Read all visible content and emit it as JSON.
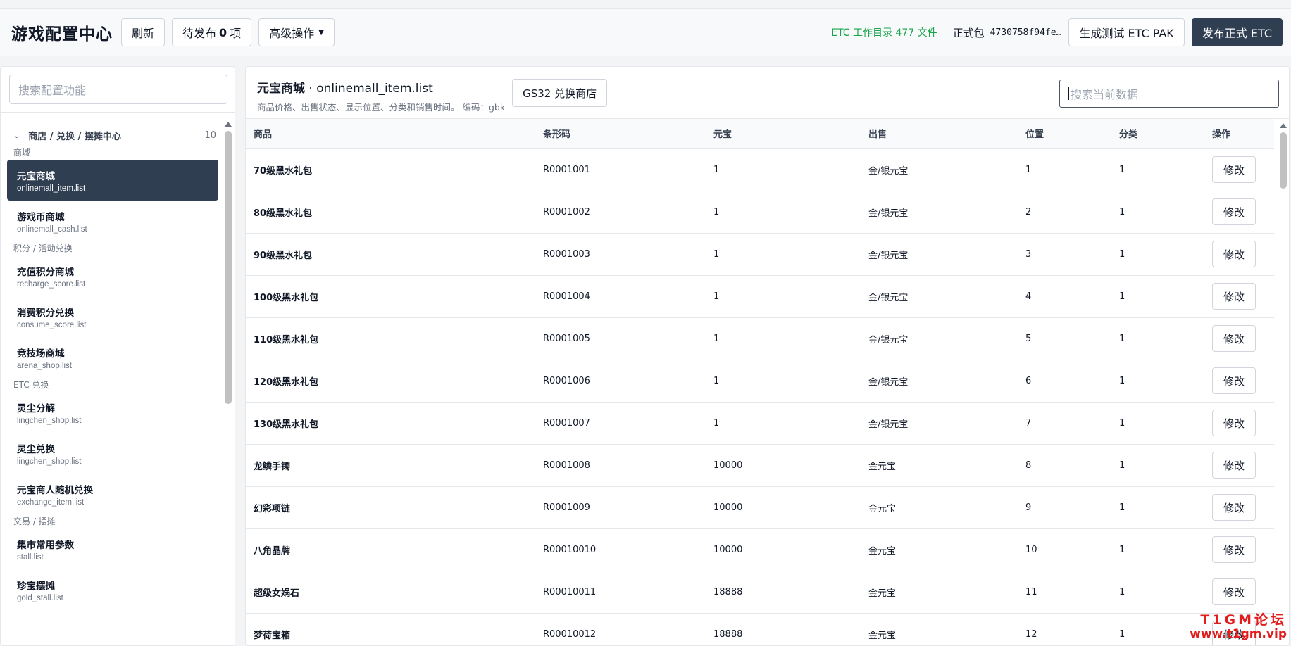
{
  "header": {
    "title": "游戏配置中心",
    "refresh_label": "刷新",
    "pending_prefix": "待发布",
    "pending_count": "0",
    "pending_suffix": "项",
    "advanced_label": "高级操作",
    "etc_count_text": "ETC 工作目录 477 文件",
    "pkg_label": "正式包",
    "pkg_hash": "4730758f94fe…",
    "build_test_label": "生成测试 ETC PAK",
    "publish_label": "发布正式 ETC"
  },
  "sidebar": {
    "search_placeholder": "搜索配置功能",
    "group": {
      "label": "商店 / 兑换 / 摆摊中心",
      "count": "10"
    },
    "sections": [
      {
        "label": "商城",
        "items": [
          {
            "title": "元宝商城",
            "file": "onlinemall_item.list",
            "active": true
          },
          {
            "title": "游戏币商城",
            "file": "onlinemall_cash.list"
          }
        ]
      },
      {
        "label": "积分 / 活动兑换",
        "items": [
          {
            "title": "充值积分商城",
            "file": "recharge_score.list"
          },
          {
            "title": "消费积分兑换",
            "file": "consume_score.list"
          },
          {
            "title": "竞技场商城",
            "file": "arena_shop.list"
          }
        ]
      },
      {
        "label": "ETC 兑换",
        "items": [
          {
            "title": "灵尘分解",
            "file": "lingchen_shop.list"
          },
          {
            "title": "灵尘兑换",
            "file": "lingchen_shop.list"
          },
          {
            "title": "元宝商人随机兑换",
            "file": "exchange_item.list"
          }
        ]
      },
      {
        "label": "交易 / 摆摊",
        "items": [
          {
            "title": "集市常用参数",
            "file": "stall.list"
          },
          {
            "title": "珍宝摆摊",
            "file": "gold_stall.list"
          }
        ]
      }
    ]
  },
  "main": {
    "title": "元宝商城",
    "file": " · onlinemall_item.list",
    "description": "商品价格、出售状态、显示位置、分类和销售时间。 编码：gbk",
    "alt_button": "GS32 兑换商店",
    "search_placeholder": "搜索当前数据",
    "columns": [
      "商品",
      "条形码",
      "元宝",
      "出售",
      "位置",
      "分类",
      "操作"
    ],
    "edit_label": "修改",
    "rows": [
      [
        "70级黑水礼包",
        "R0001001",
        "1",
        "金/银元宝",
        "1",
        "1"
      ],
      [
        "80级黑水礼包",
        "R0001002",
        "1",
        "金/银元宝",
        "2",
        "1"
      ],
      [
        "90级黑水礼包",
        "R0001003",
        "1",
        "金/银元宝",
        "3",
        "1"
      ],
      [
        "100级黑水礼包",
        "R0001004",
        "1",
        "金/银元宝",
        "4",
        "1"
      ],
      [
        "110级黑水礼包",
        "R0001005",
        "1",
        "金/银元宝",
        "5",
        "1"
      ],
      [
        "120级黑水礼包",
        "R0001006",
        "1",
        "金/银元宝",
        "6",
        "1"
      ],
      [
        "130级黑水礼包",
        "R0001007",
        "1",
        "金/银元宝",
        "7",
        "1"
      ],
      [
        "龙鳞手镯",
        "R0001008",
        "10000",
        "金元宝",
        "8",
        "1"
      ],
      [
        "幻彩项链",
        "R0001009",
        "10000",
        "金元宝",
        "9",
        "1"
      ],
      [
        "八角晶牌",
        "R00010010",
        "10000",
        "金元宝",
        "10",
        "1"
      ],
      [
        "超级女娲石",
        "R00010011",
        "18888",
        "金元宝",
        "11",
        "1"
      ],
      [
        "梦荷宝箱",
        "R00010012",
        "18888",
        "金元宝",
        "12",
        "1"
      ]
    ]
  },
  "watermark": {
    "line1": "T1GM论坛",
    "line2": "www.t1gm.vip"
  },
  "colors": {
    "accent_dark": "#2f3e51",
    "success": "#16a34a",
    "watermark": "#e11d1d"
  }
}
